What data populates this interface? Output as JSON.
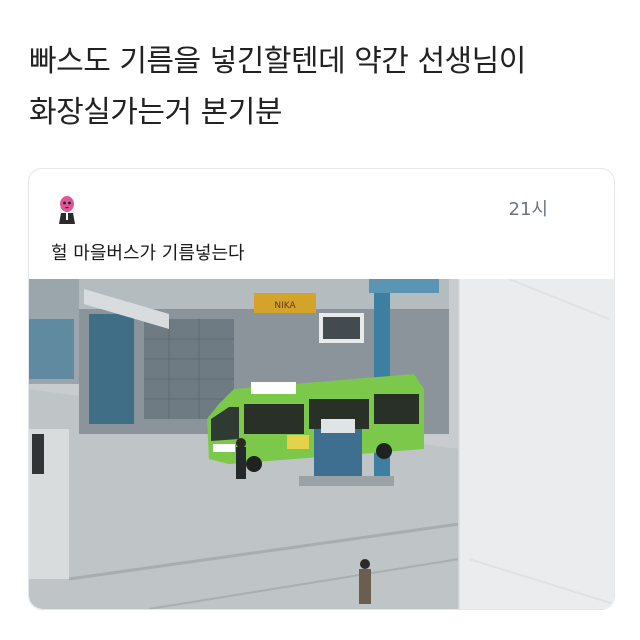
{
  "post": {
    "headline_line1": "빠스도 기름을 넣긴할텐데 약간 선생님이",
    "headline_line2": "화장실가는거 본기분"
  },
  "embedded_tweet": {
    "time": "21시",
    "text": "헐 마을버스가 기름넣는다",
    "avatar_icon": "pink-character-avatar-icon"
  },
  "photo": {
    "description_icon": "green-bus-refueling-photo",
    "sign_text": "NIKA",
    "colors": {
      "bus_green": "#7cc84a",
      "pillar_blue": "#3a7fa0",
      "pavement": "#c9cdd0"
    }
  }
}
